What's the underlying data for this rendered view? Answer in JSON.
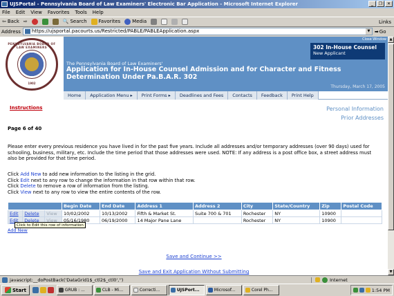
{
  "window": {
    "title": "UJSPortal - Pennsylvania Board of Law Examiners' Electronic Bar Application - Microsoft Internet Explorer",
    "controls": [
      "_",
      "❐",
      "✕"
    ]
  },
  "menu": [
    "File",
    "Edit",
    "View",
    "Favorites",
    "Tools",
    "Help"
  ],
  "toolbar": {
    "back": "Back",
    "search": "Search",
    "favorites": "Favorites",
    "media": "Media",
    "links": "Links"
  },
  "address": {
    "label": "Address",
    "url": "https://ujsportal.pacourts.us/Restricted/PABLE/PABLEApplication.aspx",
    "go": "Go"
  },
  "header": {
    "seal_text": "PENNSYLVANIA BOARD OF LAW EXAMINERS",
    "seal_year": "1902",
    "close_window": "Close Window",
    "doc_code": "302 In-House Counsel",
    "doc_status": "New Applicant",
    "board": "The Pennsylvania Board of Law Examiners'",
    "title": "Application for In-House Counsel Admission and for Character and Fitness Determination Under Pa.B.A.R. 302",
    "date": "Thursday, March 17, 2005"
  },
  "nav": [
    "Home",
    "Application Menu ▸",
    "Print Forms ▸",
    "Deadlines and Fees",
    "Contacts",
    "Feedback",
    "Print Help"
  ],
  "side": {
    "instructions": "Instructions",
    "personal": "Personal Information",
    "prior": "Prior Addresses"
  },
  "page": {
    "counter": "Page 6 of 40"
  },
  "intro": "Please enter every previous residence you have lived in for the past five years. Include all addresses and/or temporary addresses (over 90 days) used for schooling, business, military, etc. Include the time period that those addresses were used. NOTE: If any address is a post office box, a street address must also be provided for that time period.",
  "help": {
    "l1a": "Click ",
    "l1b": "Add New",
    "l1c": " to add new information to the listing in the grid.",
    "l2a": "Click ",
    "l2b": "Edit",
    "l2c": " next to any row to change the information in that row within that row.",
    "l3a": "Click ",
    "l3b": "Delete",
    "l3c": " to remove a row of information from the listing.",
    "l4a": "Click ",
    "l4b": "View",
    "l4c": " next to any row to view the entire contents of the row."
  },
  "grid": {
    "headers": [
      "Begin Date",
      "End Date",
      "Address 1",
      "Address 2",
      "City",
      "State/Country",
      "Zip",
      "Postal Code"
    ],
    "rows": [
      {
        "edit": "Edit",
        "delete": "Delete",
        "view": "View",
        "begin": "10/02/2002",
        "end": "10/13/2002",
        "addr1": "Fifth & Market St.",
        "addr2": "Suite 700 & 701",
        "city": "Rochester",
        "state": "NY",
        "zip": "10900",
        "postal": ""
      },
      {
        "edit": "Edit",
        "delete": "Delete",
        "view": "View",
        "begin": "05/16/1980",
        "end": "06/19/2000",
        "addr1": "14 Major Pane Lane",
        "addr2": "",
        "city": "Rochester",
        "state": "NY",
        "zip": "10900",
        "postal": ""
      }
    ],
    "tooltip": "Click to Edit this row of information",
    "add_new": "Add New"
  },
  "actions": {
    "save_continue": "Save and Continue >>",
    "save_exit": "Save and Exit Application Without Submitting"
  },
  "status": {
    "text": "javascript:__doPostBack('DataGrid1$_ctl2$_ctl0','')",
    "zone": "Internet"
  },
  "taskbar": {
    "start": "Start",
    "tasks": [
      "GRUB : ...",
      "CLB - Mi...",
      "Correcti...",
      "UJSPort...",
      "Microsof...",
      "Corel Ph..."
    ],
    "clock": "1:54 PM"
  }
}
